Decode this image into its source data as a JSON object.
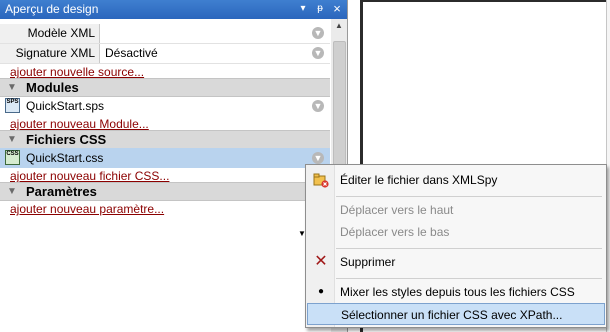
{
  "panel": {
    "title": "Aperçu de design",
    "controls": {
      "pin": "▾",
      "autohide": "ᵽ",
      "close": "×"
    },
    "properties": [
      {
        "label": "Modèle XML",
        "value": ""
      },
      {
        "label": "Signature XML",
        "value": "Désactivé"
      }
    ],
    "add_source": "ajouter nouvelle source...",
    "sections": {
      "modules": {
        "title": "Modules",
        "file": "QuickStart.sps",
        "add": "ajouter nouveau Module..."
      },
      "css": {
        "title": "Fichiers CSS",
        "file": "QuickStart.css",
        "add": "ajouter nouveau fichier CSS..."
      },
      "params": {
        "title": "Paramètres",
        "add": "ajouter nouveau paramètre..."
      }
    }
  },
  "context_menu": {
    "items": [
      {
        "label": "Éditer le fichier dans XMLSpy",
        "enabled": true
      },
      {
        "label": "Déplacer vers le haut",
        "enabled": false
      },
      {
        "label": "Déplacer vers le bas",
        "enabled": false
      },
      {
        "label": "Supprimer",
        "enabled": true
      },
      {
        "label": "Mixer les styles depuis tous les fichiers CSS",
        "enabled": true,
        "checked": true
      },
      {
        "label": "Sélectionner un fichier CSS avec XPath...",
        "enabled": true,
        "highlighted": true
      }
    ]
  },
  "colors": {
    "title_bar": "#2a66bd",
    "link": "#8b0000",
    "selection": "#b9d3ee",
    "menu_highlight": "#c9e0f7"
  },
  "icons": [
    "circle-arrow-icon",
    "sps-file-icon",
    "css-file-icon",
    "edit-xmlspy-icon",
    "delete-x-icon",
    "radio-dot-icon"
  ]
}
